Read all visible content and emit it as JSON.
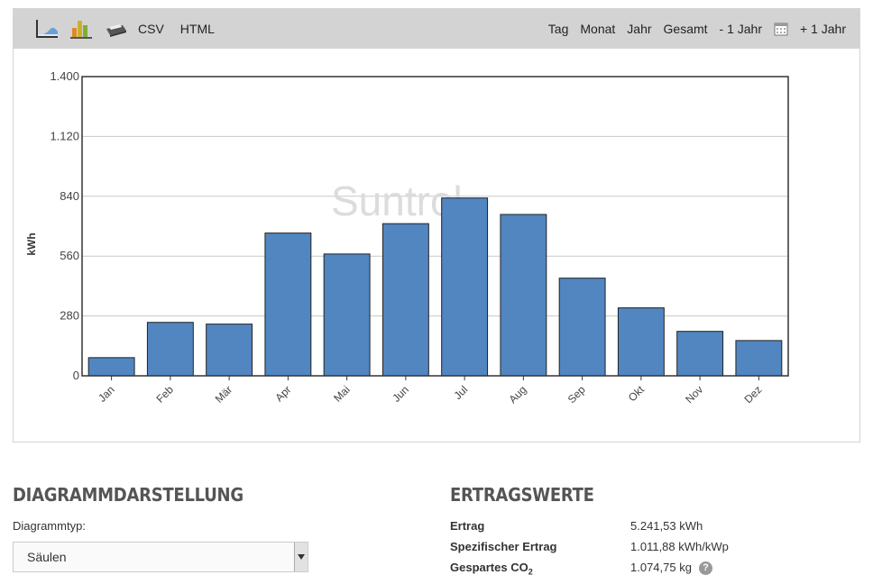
{
  "toolbar": {
    "left_icons": [
      "line-chart-icon",
      "bar-chart-icon",
      "print-icon"
    ],
    "csv_label": "CSV",
    "html_label": "HTML",
    "tag_label": "Tag",
    "monat_label": "Monat",
    "jahr_label": "Jahr",
    "gesamt_label": "Gesamt",
    "prev_year_label": "- 1 Jahr",
    "next_year_label": "+ 1 Jahr",
    "calendar_icon": "calendar-icon"
  },
  "chart_data": {
    "type": "bar",
    "categories": [
      "Jan",
      "Feb",
      "Mär",
      "Apr",
      "Mai",
      "Jun",
      "Jul",
      "Aug",
      "Sep",
      "Okt",
      "Nov",
      "Dez"
    ],
    "values": [
      85,
      250,
      242,
      668,
      570,
      712,
      832,
      755,
      457,
      318,
      208,
      165
    ],
    "ylabel": "kWh",
    "ylim": [
      0,
      1400
    ],
    "yticks": [
      0,
      280,
      560,
      840,
      1120,
      1400
    ],
    "ytick_labels": [
      "0",
      "280",
      "560",
      "840",
      "1.120",
      "1.400"
    ],
    "grid": true,
    "bar_color": "#5186c0",
    "watermark": "Suntrol"
  },
  "diagram": {
    "title": "DIAGRAMMDARSTELLUNG",
    "type_label": "Diagrammtyp:",
    "type_value": "Säulen"
  },
  "yield": {
    "title": "ERTRAGSWERTE",
    "rows": [
      {
        "label": "Ertrag",
        "value": "5.241,53 kWh"
      },
      {
        "label": "Spezifischer Ertrag",
        "value": "1.011,88 kWh/kWp"
      },
      {
        "label_main": "Gespartes CO",
        "label_sub": "2",
        "value": "1.074,75 kg"
      }
    ],
    "help_icon": "help-icon"
  }
}
